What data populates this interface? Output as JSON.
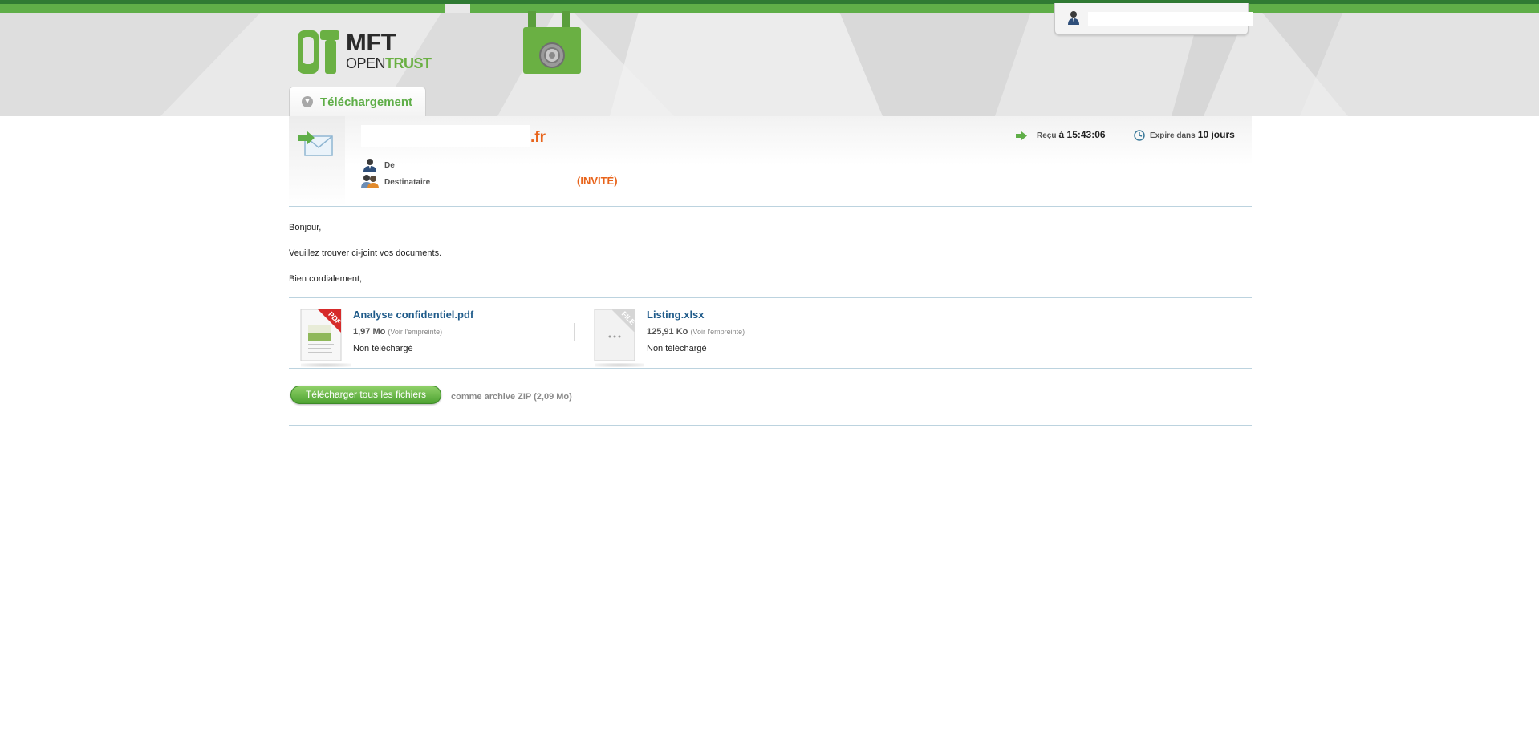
{
  "header": {
    "user_name": "",
    "logo_line1": "MFT",
    "logo_line2_part1": "OPEN",
    "logo_line2_part2": "TRUST",
    "tab_label": "Téléchargement"
  },
  "message": {
    "subject_suffix": ".fr",
    "from_label": "De",
    "to_label": "Destinataire",
    "to_tag": "(INVITÉ)",
    "received_label": "Reçu",
    "received_time": "à 15:43:06",
    "expire_label": "Expire dans",
    "expire_value": "10 jours"
  },
  "body": {
    "line1": "Bonjour,",
    "line2": "Veuillez trouver ci-joint vos documents.",
    "line3": "Bien cordialement,"
  },
  "files": [
    {
      "name": "Analyse confidentiel.pdf",
      "size": "1,97 Mo",
      "fingerprint_link": "(Voir l'empreinte)",
      "status": "Non téléchargé",
      "badge": "PDF"
    },
    {
      "name": "Listing.xlsx",
      "size": "125,91 Ko",
      "fingerprint_link": "(Voir l'empreinte)",
      "status": "Non téléchargé",
      "badge": "FILE"
    }
  ],
  "download": {
    "button_label": "Télécharger tous les fichiers",
    "note": "comme archive ZIP (2,09 Mo)"
  },
  "colors": {
    "brand_green": "#5fae48",
    "accent_orange": "#e8641b",
    "link_blue": "#1f5b8a"
  }
}
